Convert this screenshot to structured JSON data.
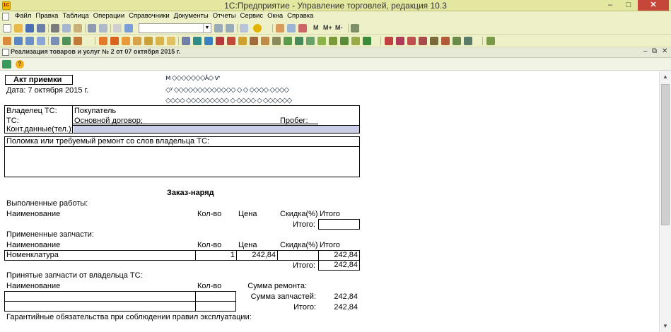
{
  "window": {
    "title": "1С:Предприятие - Управление торговлей, редакция 10.3",
    "app_icon": "1C",
    "min": "–",
    "max": "□",
    "close": "✕"
  },
  "menu": [
    "Файл",
    "Правка",
    "Таблица",
    "Операции",
    "Справочники",
    "Документы",
    "Отчеты",
    "Сервис",
    "Окна",
    "Справка"
  ],
  "toolbar": {
    "zoom_buttons": [
      "M",
      "M+",
      "M-"
    ]
  },
  "document": {
    "title": "Реализация товаров и услуг № 2 от 07 октября 2015 г.",
    "controls": {
      "minimize": "–",
      "restore": "⧉",
      "close": "✕"
    }
  },
  "form": {
    "header": "Акт приемки",
    "date": "Дата: 7 октября 2015 г.",
    "owner_label": "Владелец ТС:",
    "owner_value": "Покупатель",
    "vehicle_label": "ТС:",
    "contract_value": "Основной договор;",
    "mileage_label": "Пробег:",
    "contacts_label": "Конт.данные(тел.):",
    "defect_label": "Поломка или требуемый ремонт со слов владельца ТС:",
    "order_title": "Заказ-наряд",
    "works": {
      "title": "Выполненные работы:",
      "columns": [
        "Наименование",
        "Кол-во",
        "Цена",
        "Скидка(%)",
        "Итого"
      ],
      "total_label": "Итого:",
      "total_value": ""
    },
    "parts": {
      "title": "Примененные запчасти:",
      "columns": [
        "Наименование",
        "Кол-во",
        "Цена",
        "Скидка(%)",
        "Итого"
      ],
      "rows": [
        {
          "name": "Номенклатура",
          "qty": "1",
          "price": "242,84",
          "discount": "",
          "total": "242,84"
        }
      ],
      "total_label": "Итого:",
      "total_value": "242,84"
    },
    "accepted_parts": {
      "title": "Принятые запчасти от владельца ТС:",
      "columns": [
        "Наименование",
        "Кол-во"
      ]
    },
    "summary": {
      "repair_label": "Сумма ремонта:",
      "repair_value": "",
      "parts_label": "Сумма запчастей:",
      "parts_value": "242,84",
      "total_label": "Итого:",
      "total_value": "242,84"
    },
    "warranty": "Гарантийные обязательства при соблюдении правил эксплуатации:"
  },
  "colors": {
    "titlebar": "#e3e7a0",
    "toolbar": "#eef1c8",
    "close": "#c7463a",
    "highlight": "#c9cde6"
  }
}
